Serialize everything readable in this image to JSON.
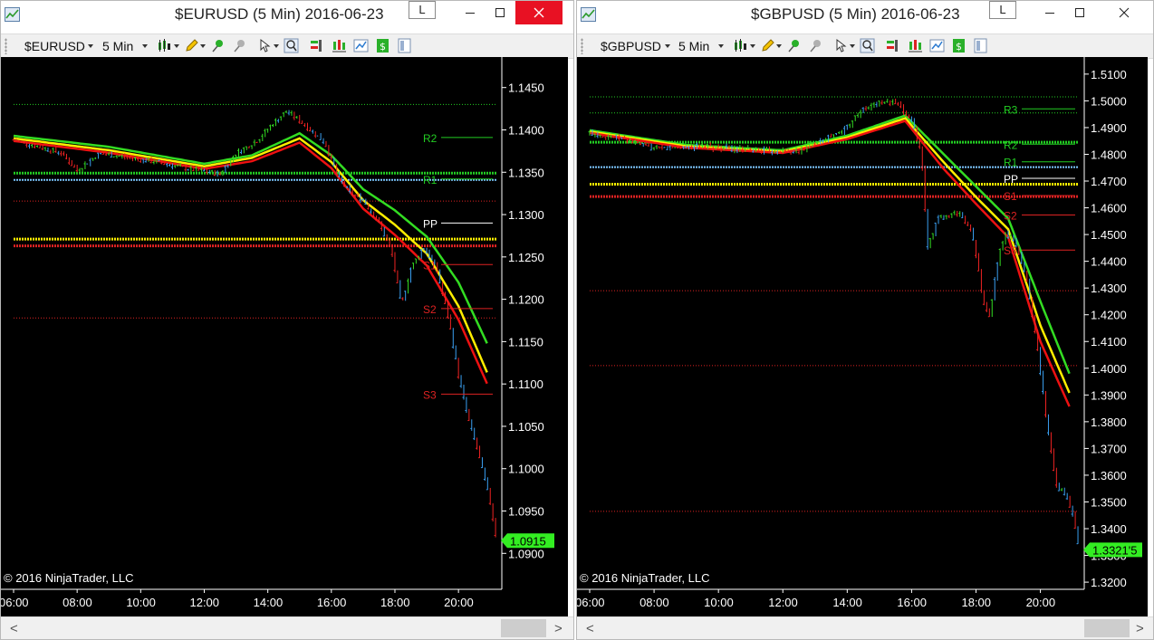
{
  "windows": [
    {
      "title": "$EURUSD (5 Min)  2016-06-23",
      "l_button": "L",
      "toolbar": {
        "instrument": "$EURUSD",
        "interval": "5 Min"
      },
      "copyright": "© 2016 NinjaTrader, LLC",
      "chart_data": {
        "type": "candlestick",
        "price_axis": {
          "range": [
            1.088,
            1.147
          ],
          "ticks": [
            "1.1450",
            "1.1400",
            "1.1350",
            "1.1300",
            "1.1250",
            "1.1200",
            "1.1150",
            "1.1100",
            "1.1050",
            "1.1000",
            "1.0950",
            "1.0900"
          ]
        },
        "time_axis": {
          "ticks": [
            "06:00",
            "08:00",
            "10:00",
            "12:00",
            "14:00",
            "16:00",
            "18:00",
            "20:00"
          ]
        },
        "last_price": "1.0915",
        "pivots": [
          {
            "label": "R2",
            "value": 1.1391,
            "color": "#22cc22"
          },
          {
            "label": "R1",
            "value": 1.1342,
            "color": "#22cc22"
          },
          {
            "label": "PP",
            "value": 1.129,
            "color": "#ffffff"
          },
          {
            "label": "S1",
            "value": 1.1241,
            "color": "#dd2222"
          },
          {
            "label": "S2",
            "value": 1.1189,
            "color": "#dd2222"
          },
          {
            "label": "S3",
            "value": 1.1088,
            "color": "#dd2222"
          }
        ],
        "levels": [
          {
            "value": 1.143,
            "color": "#22cc22",
            "style": "dotted",
            "weight": 1
          },
          {
            "value": 1.1349,
            "color": "#22cc22",
            "style": "dotted",
            "weight": 3
          },
          {
            "value": 1.1341,
            "color": "#7ec8ff",
            "style": "dotted",
            "weight": 2
          },
          {
            "value": 1.1316,
            "color": "#dd2222",
            "style": "dotted",
            "weight": 1
          },
          {
            "value": 1.1271,
            "color": "#ffee00",
            "style": "dotted",
            "weight": 3
          },
          {
            "value": 1.1263,
            "color": "#dd2222",
            "style": "dotted",
            "weight": 3
          },
          {
            "value": 1.1178,
            "color": "#dd2222",
            "style": "dotted",
            "weight": 1
          }
        ],
        "price_path": [
          [
            6.0,
            1.1388
          ],
          [
            7.5,
            1.1373
          ],
          [
            8.0,
            1.1352
          ],
          [
            8.7,
            1.1372
          ],
          [
            9.5,
            1.1368
          ],
          [
            10.5,
            1.1362
          ],
          [
            11.5,
            1.1354
          ],
          [
            12.5,
            1.1348
          ],
          [
            13.0,
            1.1372
          ],
          [
            13.7,
            1.1388
          ],
          [
            14.1,
            1.1405
          ],
          [
            14.6,
            1.1422
          ],
          [
            15.1,
            1.1408
          ],
          [
            15.8,
            1.1385
          ],
          [
            16.2,
            1.1345
          ],
          [
            16.6,
            1.1325
          ],
          [
            17.0,
            1.1318
          ],
          [
            17.5,
            1.129
          ],
          [
            17.9,
            1.1256
          ],
          [
            18.2,
            1.1192
          ],
          [
            18.5,
            1.1236
          ],
          [
            18.9,
            1.1262
          ],
          [
            19.3,
            1.1238
          ],
          [
            19.7,
            1.1175
          ],
          [
            20.0,
            1.111
          ],
          [
            20.3,
            1.106
          ],
          [
            20.6,
            1.1022
          ],
          [
            21.0,
            1.096
          ],
          [
            21.2,
            1.0915
          ]
        ],
        "moving_averages": [
          {
            "color": "#33dd22",
            "points": [
              [
                6.0,
                1.1393
              ],
              [
                9.0,
                1.138
              ],
              [
                12.0,
                1.136
              ],
              [
                13.5,
                1.137
              ],
              [
                15.0,
                1.1396
              ],
              [
                16.0,
                1.137
              ],
              [
                17.0,
                1.133
              ],
              [
                18.0,
                1.1305
              ],
              [
                19.0,
                1.1274
              ],
              [
                20.0,
                1.122
              ],
              [
                21.0,
                1.114
              ]
            ]
          },
          {
            "color": "#ffee00",
            "points": [
              [
                6.0,
                1.139
              ],
              [
                9.0,
                1.1376
              ],
              [
                12.0,
                1.1357
              ],
              [
                13.5,
                1.1367
              ],
              [
                15.0,
                1.139
              ],
              [
                16.0,
                1.1362
              ],
              [
                17.0,
                1.1317
              ],
              [
                18.0,
                1.1288
              ],
              [
                19.0,
                1.1254
              ],
              [
                20.0,
                1.1192
              ],
              [
                21.0,
                1.1105
              ]
            ]
          },
          {
            "color": "#ee1111",
            "points": [
              [
                6.0,
                1.1387
              ],
              [
                9.0,
                1.1373
              ],
              [
                12.0,
                1.1354
              ],
              [
                13.5,
                1.1363
              ],
              [
                15.0,
                1.1385
              ],
              [
                16.0,
                1.1355
              ],
              [
                17.0,
                1.1307
              ],
              [
                18.0,
                1.1276
              ],
              [
                19.0,
                1.124
              ],
              [
                20.0,
                1.1176
              ],
              [
                21.0,
                1.1092
              ]
            ]
          }
        ]
      }
    },
    {
      "title": "$GBPUSD (5 Min)  2016-06-23",
      "l_button": "L",
      "toolbar": {
        "instrument": "$GBPUSD",
        "interval": "5 Min"
      },
      "copyright": "© 2016 NinjaTrader, LLC",
      "chart_data": {
        "type": "candlestick",
        "price_axis": {
          "range": [
            1.318,
            1.513
          ],
          "ticks": [
            "1.5100",
            "1.5000",
            "1.4900",
            "1.4800",
            "1.4700",
            "1.4600",
            "1.4500",
            "1.4400",
            "1.4300",
            "1.4200",
            "1.4100",
            "1.4000",
            "1.3900",
            "1.3800",
            "1.3700",
            "1.3600",
            "1.3500",
            "1.3400",
            "1.3300",
            "1.3200"
          ]
        },
        "time_axis": {
          "ticks": [
            "06:00",
            "08:00",
            "10:00",
            "12:00",
            "14:00",
            "16:00",
            "18:00",
            "20:00"
          ]
        },
        "last_price": "1.3321'5",
        "pivots": [
          {
            "label": "R3",
            "value": 1.497,
            "color": "#22cc22"
          },
          {
            "label": "R2",
            "value": 1.4838,
            "color": "#22cc22"
          },
          {
            "label": "R1",
            "value": 1.4772,
            "color": "#22cc22"
          },
          {
            "label": "PP",
            "value": 1.471,
            "color": "#ffffff"
          },
          {
            "label": "S1",
            "value": 1.4646,
            "color": "#dd2222"
          },
          {
            "label": "S2",
            "value": 1.4573,
            "color": "#dd2222"
          },
          {
            "label": "S3",
            "value": 1.4442,
            "color": "#dd2222"
          }
        ],
        "levels": [
          {
            "value": 1.5015,
            "color": "#22cc22",
            "style": "dotted",
            "weight": 1
          },
          {
            "value": 1.4955,
            "color": "#22cc22",
            "style": "dotted",
            "weight": 1
          },
          {
            "value": 1.4845,
            "color": "#22cc22",
            "style": "dotted",
            "weight": 3
          },
          {
            "value": 1.4752,
            "color": "#7ec8ff",
            "style": "dotted",
            "weight": 2
          },
          {
            "value": 1.4688,
            "color": "#ffee00",
            "style": "dotted",
            "weight": 3
          },
          {
            "value": 1.4642,
            "color": "#dd2222",
            "style": "dotted",
            "weight": 3
          },
          {
            "value": 1.429,
            "color": "#dd2222",
            "style": "dotted",
            "weight": 1
          },
          {
            "value": 1.401,
            "color": "#dd2222",
            "style": "dotted",
            "weight": 1
          },
          {
            "value": 1.3465,
            "color": "#dd2222",
            "style": "dotted",
            "weight": 1
          }
        ],
        "price_path": [
          [
            6.0,
            1.488
          ],
          [
            7.0,
            1.486
          ],
          [
            8.0,
            1.482
          ],
          [
            9.5,
            1.483
          ],
          [
            11.0,
            1.4815
          ],
          [
            12.5,
            1.481
          ],
          [
            13.0,
            1.4845
          ],
          [
            13.8,
            1.488
          ],
          [
            14.4,
            1.496
          ],
          [
            15.0,
            1.4995
          ],
          [
            15.5,
            1.499
          ],
          [
            16.0,
            1.493
          ],
          [
            16.3,
            1.48
          ],
          [
            16.5,
            1.445
          ],
          [
            16.8,
            1.456
          ],
          [
            17.5,
            1.458
          ],
          [
            17.9,
            1.45
          ],
          [
            18.2,
            1.427
          ],
          [
            18.4,
            1.418
          ],
          [
            18.7,
            1.442
          ],
          [
            18.9,
            1.45
          ],
          [
            19.2,
            1.448
          ],
          [
            19.6,
            1.432
          ],
          [
            19.9,
            1.408
          ],
          [
            20.2,
            1.38
          ],
          [
            20.5,
            1.356
          ],
          [
            20.8,
            1.352
          ],
          [
            21.0,
            1.345
          ],
          [
            21.2,
            1.332
          ]
        ],
        "moving_averages": [
          {
            "color": "#33dd22",
            "points": [
              [
                6.0,
                1.489
              ],
              [
                9.0,
                1.4835
              ],
              [
                12.0,
                1.4815
              ],
              [
                14.0,
                1.487
              ],
              [
                15.8,
                1.4945
              ],
              [
                17.0,
                1.48
              ],
              [
                18.0,
                1.468
              ],
              [
                19.0,
                1.456
              ],
              [
                20.0,
                1.425
              ],
              [
                21.0,
                1.395
              ]
            ]
          },
          {
            "color": "#ffee00",
            "points": [
              [
                6.0,
                1.4885
              ],
              [
                9.0,
                1.483
              ],
              [
                12.0,
                1.481
              ],
              [
                14.0,
                1.4863
              ],
              [
                15.8,
                1.4935
              ],
              [
                17.0,
                1.477
              ],
              [
                18.0,
                1.464
              ],
              [
                19.0,
                1.452
              ],
              [
                20.0,
                1.416
              ],
              [
                21.0,
                1.388
              ]
            ]
          },
          {
            "color": "#ee1111",
            "points": [
              [
                6.0,
                1.488
              ],
              [
                9.0,
                1.4825
              ],
              [
                12.0,
                1.4805
              ],
              [
                14.0,
                1.4857
              ],
              [
                15.8,
                1.4925
              ],
              [
                17.0,
                1.4745
              ],
              [
                18.0,
                1.4615
              ],
              [
                19.0,
                1.449
              ],
              [
                20.0,
                1.41
              ],
              [
                21.0,
                1.383
              ]
            ]
          }
        ]
      }
    }
  ]
}
